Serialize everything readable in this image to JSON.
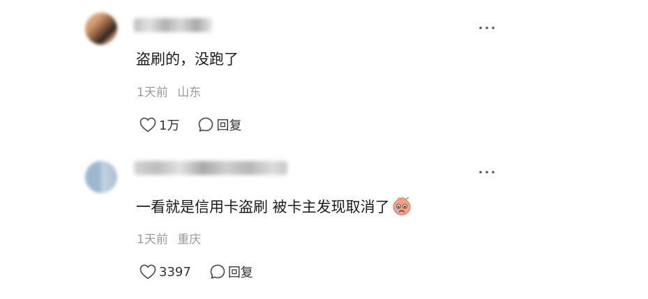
{
  "comments": [
    {
      "text": "盗刷的，没跑了",
      "time": "1天前",
      "location": "山东",
      "likes": "1万",
      "reply_label": "回复",
      "icons": {
        "more": "more-horizontal-icon",
        "like": "heart-outline-icon",
        "reply": "comment-bubble-icon"
      }
    },
    {
      "text": "一看就是信用卡盗刷 被卡主发现取消了",
      "emoji": "crying-face-emoji",
      "time": "1天前",
      "location": "重庆",
      "likes": "3397",
      "reply_label": "回复",
      "icons": {
        "more": "more-horizontal-icon",
        "like": "heart-outline-icon",
        "reply": "comment-bubble-icon"
      }
    }
  ],
  "colors": {
    "text_primary": "#1a1a1a",
    "text_meta": "#9a9a9a",
    "icon": "#555555",
    "emoji_face": "#f4a38a"
  }
}
